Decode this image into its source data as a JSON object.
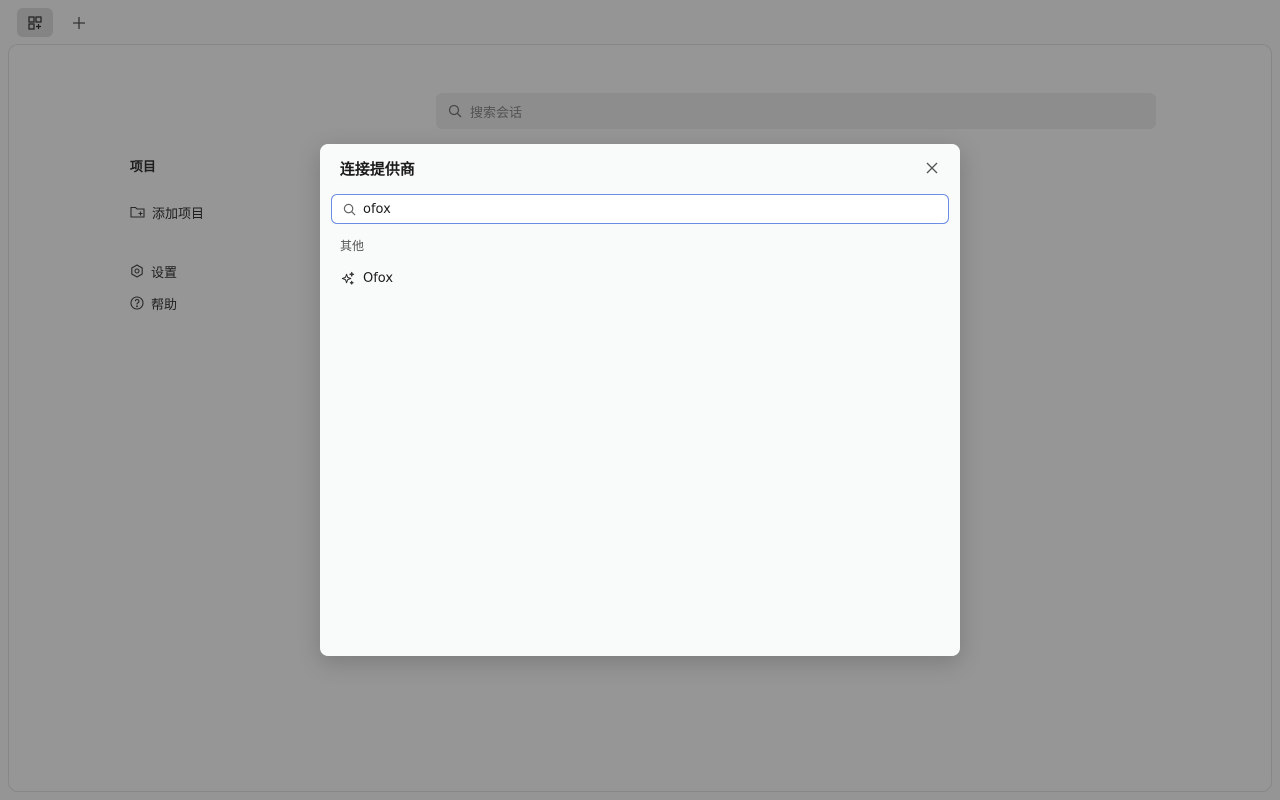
{
  "tabbar": {
    "tabs": [
      {
        "icon": "grid-plus-icon"
      }
    ],
    "add_tab_icon": "plus-icon"
  },
  "main": {
    "search": {
      "placeholder": "搜索会话",
      "icon": "search-icon"
    },
    "sidebar": {
      "section_title": "项目",
      "add_project": {
        "label": "添加项目",
        "icon": "folder-plus-icon"
      },
      "settings": {
        "label": "设置",
        "icon": "gear-icon"
      },
      "help": {
        "label": "帮助",
        "icon": "help-circle-icon"
      }
    }
  },
  "dialog": {
    "title": "连接提供商",
    "close_icon": "close-icon",
    "search": {
      "value": "ofox",
      "icon": "search-icon"
    },
    "groups": [
      {
        "label": "其他",
        "items": [
          {
            "label": "Ofox",
            "icon": "sparkles-icon"
          }
        ]
      }
    ]
  },
  "colors": {
    "overlay": "rgba(0,0,0,0.40)",
    "accent_border": "#6b8de3",
    "dialog_bg": "#f9fafa"
  }
}
